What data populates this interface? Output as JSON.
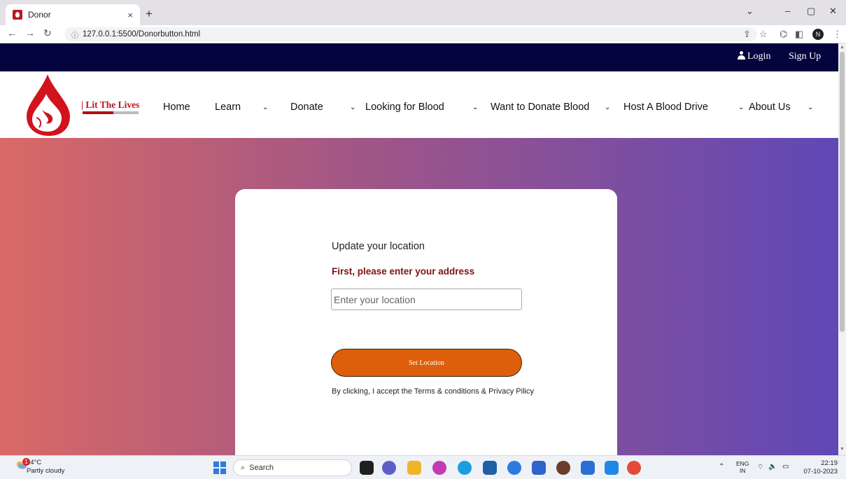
{
  "browser": {
    "tab_title": "Donor",
    "tab_close": "×",
    "new_tab": "+",
    "url": "127.0.0.1:5500/Donorbutton.html",
    "controls": {
      "minimize": "–",
      "restore": "▢",
      "close": "✕",
      "dropdown": "⌄"
    }
  },
  "topbar": {
    "login_label": "Login",
    "signup_label": "Sign Up"
  },
  "brand": {
    "name": "| Lit The Lives"
  },
  "nav": {
    "items": [
      "Home",
      "Learn",
      "Donate",
      "Looking for Blood",
      "Want to Donate Blood",
      "Host A Blood Drive",
      "About Us"
    ],
    "chevron": "⌄"
  },
  "card": {
    "heading": "Update your location",
    "subheading": "First, please enter your address",
    "location_placeholder": "Enter your location",
    "button_label": "Set Location",
    "terms_text": "By clicking, I accept the Terms & conditions & Privacy Pilicy"
  },
  "taskbar": {
    "weather": {
      "temp": "24°C",
      "condition": "Partly cloudy",
      "badge": "1"
    },
    "search_label": "Search",
    "language": {
      "line1": "ENG",
      "line2": "IN"
    },
    "clock": {
      "time": "22:19",
      "date": "07-10-2023"
    }
  },
  "colors": {
    "topbar": "#04043f",
    "brand": "#c0161e",
    "subheading": "#7b1414",
    "button": "#de5f0b",
    "gradient_start": "#d96966",
    "gradient_end": "#5f48b6"
  }
}
